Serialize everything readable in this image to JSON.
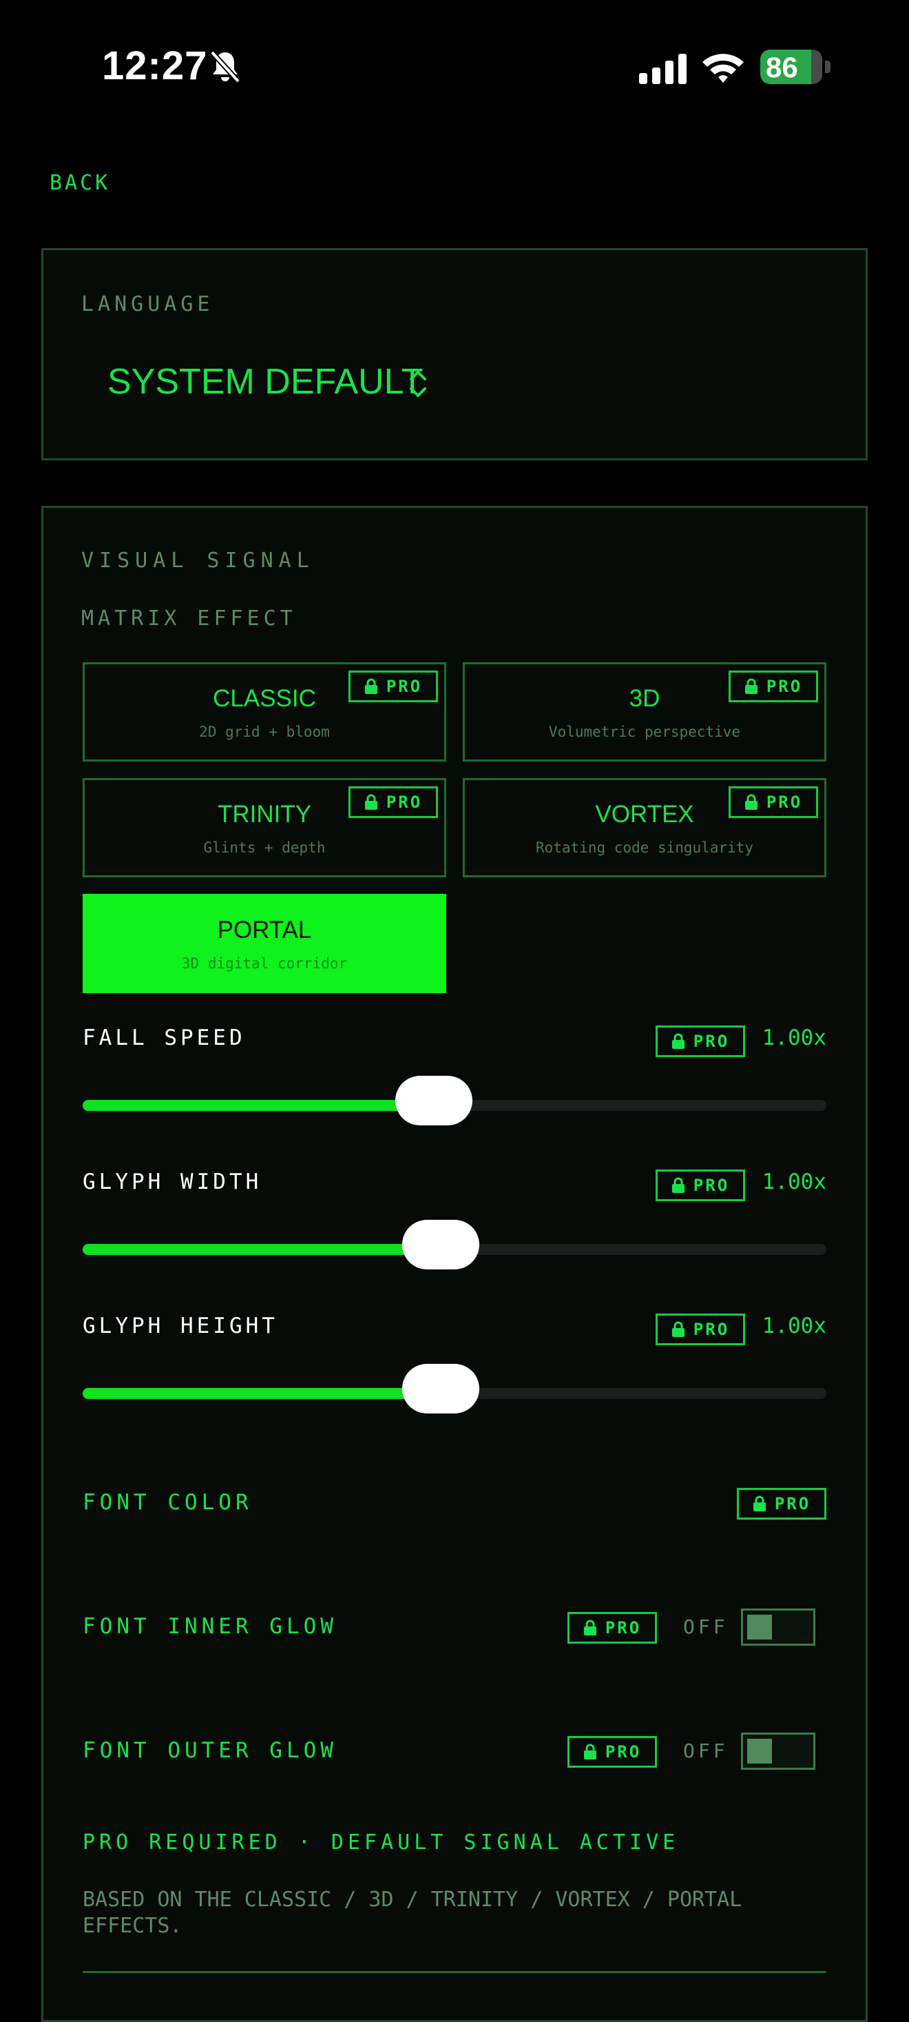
{
  "status_bar": {
    "time": "12:27",
    "battery": "86"
  },
  "nav": {
    "back_label": "BACK"
  },
  "language": {
    "label": "LANGUAGE",
    "value": "SYSTEM DEFAULT"
  },
  "visual_signal": {
    "label": "VISUAL SIGNAL",
    "matrix_effect_label": "MATRIX EFFECT",
    "pro_badge": "PRO",
    "effects": [
      {
        "title": "CLASSIC",
        "subtitle": "2D grid + bloom",
        "locked": true,
        "selected": false
      },
      {
        "title": "3D",
        "subtitle": "Volumetric perspective",
        "locked": true,
        "selected": false
      },
      {
        "title": "TRINITY",
        "subtitle": "Glints + depth",
        "locked": true,
        "selected": false
      },
      {
        "title": "VORTEX",
        "subtitle": "Rotating code singularity",
        "locked": true,
        "selected": false
      },
      {
        "title": "PORTAL",
        "subtitle": "3D digital corridor",
        "locked": false,
        "selected": true
      }
    ],
    "sliders": [
      {
        "label": "FALL SPEED",
        "value": "1.00x",
        "level": 0.42
      },
      {
        "label": "GLYPH WIDTH",
        "value": "1.00x",
        "level": 0.43
      },
      {
        "label": "GLYPH HEIGHT",
        "value": "1.00x",
        "level": 0.43
      }
    ],
    "font_color_label": "FONT COLOR",
    "inner_glow": {
      "label": "FONT INNER GLOW",
      "state": "OFF"
    },
    "outer_glow": {
      "label": "FONT OUTER GLOW",
      "state": "OFF"
    },
    "pro_required": "PRO REQUIRED · DEFAULT SIGNAL ACTIVE",
    "based_on": "BASED ON THE CLASSIC / 3D / TRINITY / VORTEX / PORTAL EFFECTS."
  },
  "colors": {
    "accent": "#19e34a",
    "selected_fill": "#0ff21b",
    "panel_border": "#1d4a29",
    "muted": "#5d8a68"
  }
}
